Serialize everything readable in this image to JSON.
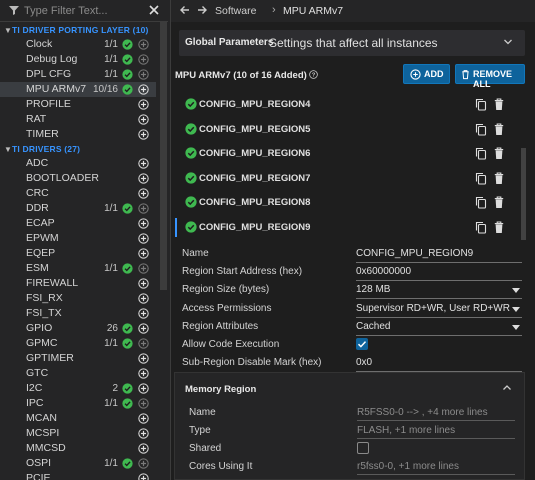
{
  "filter": {
    "placeholder": "Type Filter Text..."
  },
  "sections": [
    {
      "title": "TI DRIVER PORTING LAYER (10)"
    },
    {
      "title": "TI DRIVERS (27)"
    }
  ],
  "porting_items": [
    {
      "label": "Clock",
      "count": "1/1",
      "configured": true
    },
    {
      "label": "Debug Log",
      "count": "1/1",
      "configured": true
    },
    {
      "label": "DPL CFG",
      "count": "1/1",
      "configured": true
    },
    {
      "label": "MPU ARMv7",
      "count": "10/16",
      "configured": true,
      "selected": true
    },
    {
      "label": "PROFILE",
      "count": "",
      "configured": false
    },
    {
      "label": "RAT",
      "count": "",
      "configured": false
    },
    {
      "label": "TIMER",
      "count": "",
      "configured": false
    }
  ],
  "driver_items": [
    {
      "label": "ADC",
      "count": "",
      "configured": false
    },
    {
      "label": "BOOTLOADER",
      "count": "",
      "configured": false
    },
    {
      "label": "CRC",
      "count": "",
      "configured": false
    },
    {
      "label": "DDR",
      "count": "1/1",
      "configured": true
    },
    {
      "label": "ECAP",
      "count": "",
      "configured": false
    },
    {
      "label": "EPWM",
      "count": "",
      "configured": false
    },
    {
      "label": "EQEP",
      "count": "",
      "configured": false
    },
    {
      "label": "ESM",
      "count": "1/1",
      "configured": true
    },
    {
      "label": "FIREWALL",
      "count": "",
      "configured": false
    },
    {
      "label": "FSI_RX",
      "count": "",
      "configured": false
    },
    {
      "label": "FSI_TX",
      "count": "",
      "configured": false
    },
    {
      "label": "GPIO",
      "count": "26",
      "configured": true
    },
    {
      "label": "GPMC",
      "count": "1/1",
      "configured": true
    },
    {
      "label": "GPTIMER",
      "count": "",
      "configured": false
    },
    {
      "label": "GTC",
      "count": "",
      "configured": false
    },
    {
      "label": "I2C",
      "count": "2",
      "configured": true
    },
    {
      "label": "IPC",
      "count": "1/1",
      "configured": true
    },
    {
      "label": "MCAN",
      "count": "",
      "configured": false
    },
    {
      "label": "MCSPI",
      "count": "",
      "configured": false
    },
    {
      "label": "MMCSD",
      "count": "",
      "configured": false
    },
    {
      "label": "OSPI",
      "count": "1/1",
      "configured": true
    },
    {
      "label": "PCIE",
      "count": "",
      "configured": false
    }
  ],
  "breadcrumb": {
    "parent": "Software",
    "separator": "›",
    "current": "MPU ARMv7"
  },
  "global_params": {
    "title": "Global Parameters",
    "subtitle": "Settings that affect all instances"
  },
  "module": {
    "header": "MPU ARMv7 (10 of 16 Added)",
    "add_label": "ADD",
    "remove_all_label": "REMOVE ALL"
  },
  "regions": [
    {
      "name": "CONFIG_MPU_REGION4"
    },
    {
      "name": "CONFIG_MPU_REGION5"
    },
    {
      "name": "CONFIG_MPU_REGION6"
    },
    {
      "name": "CONFIG_MPU_REGION7"
    },
    {
      "name": "CONFIG_MPU_REGION8"
    },
    {
      "name": "CONFIG_MPU_REGION9"
    }
  ],
  "selected_region": "CONFIG_MPU_REGION9",
  "properties": {
    "name_label": "Name",
    "name_value": "CONFIG_MPU_REGION9",
    "start_label": "Region Start Address (hex)",
    "start_value": "0x60000000",
    "size_label": "Region Size (bytes)",
    "size_value": "128 MB",
    "access_label": "Access Permissions",
    "access_value": "Supervisor RD+WR, User RD+WR",
    "attr_label": "Region Attributes",
    "attr_value": "Cached",
    "exec_label": "Allow Code Execution",
    "exec_value": true,
    "subregion_label": "Sub-Region Disable Mark (hex)",
    "subregion_value": "0x0"
  },
  "memory_region": {
    "title": "Memory Region",
    "name_label": "Name",
    "name_value": "R5FSS0-0 --> , +4 more lines",
    "type_label": "Type",
    "type_value": "FLASH, +1 more lines",
    "shared_label": "Shared",
    "shared_value": false,
    "cores_label": "Cores Using It",
    "cores_value": "r5fss0-0, +1 more lines"
  },
  "colors": {
    "accent": "#3794ff",
    "ok_green": "#3fb950",
    "button_blue": "#0e639c"
  },
  "icons": [
    "filter-icon",
    "close-icon",
    "check-circle-icon",
    "plus-circle-icon",
    "back-arrow-icon",
    "forward-arrow-icon",
    "chevron-down-icon",
    "chevron-up-icon",
    "help-icon",
    "copy-icon",
    "trash-icon"
  ]
}
